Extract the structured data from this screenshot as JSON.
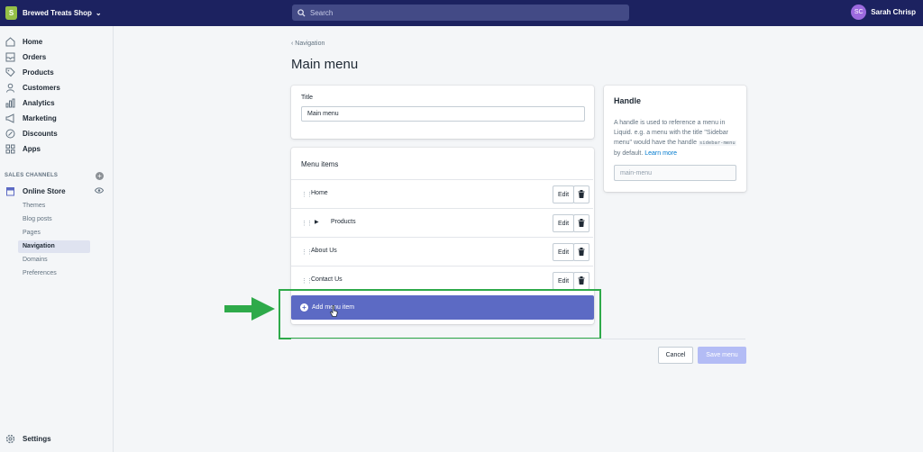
{
  "topbar": {
    "store_name": "Brewed Treats Shop",
    "search_placeholder": "Search",
    "user_initials": "SC",
    "user_name": "Sarah Chrisp"
  },
  "sidebar": {
    "items": [
      {
        "label": "Home",
        "icon": "home-icon"
      },
      {
        "label": "Orders",
        "icon": "orders-icon"
      },
      {
        "label": "Products",
        "icon": "tag-icon"
      },
      {
        "label": "Customers",
        "icon": "person-icon"
      },
      {
        "label": "Analytics",
        "icon": "bar-chart-icon"
      },
      {
        "label": "Marketing",
        "icon": "megaphone-icon"
      },
      {
        "label": "Discounts",
        "icon": "discount-icon"
      },
      {
        "label": "Apps",
        "icon": "apps-icon"
      }
    ],
    "sales_channels_label": "SALES CHANNELS",
    "online_store_label": "Online Store",
    "sub_items": [
      {
        "label": "Themes",
        "active": false
      },
      {
        "label": "Blog posts",
        "active": false
      },
      {
        "label": "Pages",
        "active": false
      },
      {
        "label": "Navigation",
        "active": true
      },
      {
        "label": "Domains",
        "active": false
      },
      {
        "label": "Preferences",
        "active": false
      }
    ],
    "settings_label": "Settings"
  },
  "main": {
    "back_label": "Navigation",
    "page_title": "Main menu",
    "title_label": "Title",
    "title_value": "Main menu",
    "menu_items_heading": "Menu items",
    "menu_items": [
      {
        "label": "Home",
        "has_children": false
      },
      {
        "label": "Products",
        "has_children": true
      },
      {
        "label": "About Us",
        "has_children": false
      },
      {
        "label": "Contact Us",
        "has_children": false
      }
    ],
    "edit_label": "Edit",
    "add_menu_item_label": "Add menu item",
    "cancel_label": "Cancel",
    "save_label": "Save menu"
  },
  "handle": {
    "heading": "Handle",
    "desc_part1": "A handle is used to reference a menu in Liquid. e.g. a menu with the title \"Sidebar menu\" would have the handle ",
    "desc_code": "sidebar-menu",
    "desc_part2": " by default. ",
    "learn_more": "Learn more",
    "value": "main-menu"
  },
  "colors": {
    "topbar": "#1c2260",
    "primary": "#5c6ac4",
    "highlight": "#2eaa4a",
    "logo": "#95bf47"
  }
}
